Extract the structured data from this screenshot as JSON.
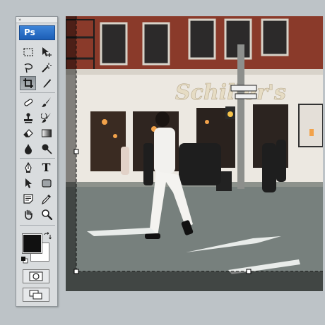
{
  "toolbox": {
    "grip": "»",
    "logo": "Ps",
    "tools": [
      {
        "name": "rectangular-marquee-tool-icon"
      },
      {
        "name": "move-tool-icon"
      },
      {
        "name": "lasso-tool-icon"
      },
      {
        "name": "magic-wand-tool-icon"
      },
      {
        "name": "crop-tool-icon",
        "active": true
      },
      {
        "name": "slice-tool-icon"
      },
      {
        "name": "healing-brush-tool-icon"
      },
      {
        "name": "brush-tool-icon"
      },
      {
        "name": "clone-stamp-tool-icon"
      },
      {
        "name": "history-brush-tool-icon"
      },
      {
        "name": "eraser-tool-icon"
      },
      {
        "name": "gradient-tool-icon"
      },
      {
        "name": "blur-tool-icon"
      },
      {
        "name": "dodge-tool-icon"
      },
      {
        "name": "pen-tool-icon"
      },
      {
        "name": "type-tool-icon",
        "glyph": "T"
      },
      {
        "name": "path-selection-tool-icon"
      },
      {
        "name": "shape-tool-icon"
      },
      {
        "name": "notes-tool-icon"
      },
      {
        "name": "eyedropper-tool-icon"
      },
      {
        "name": "hand-tool-icon"
      },
      {
        "name": "zoom-tool-icon"
      }
    ],
    "foreground_color": "#111111",
    "background_color": "#ffffff"
  },
  "canvas": {
    "sign_text": "Schiller's",
    "crop_active": true
  }
}
